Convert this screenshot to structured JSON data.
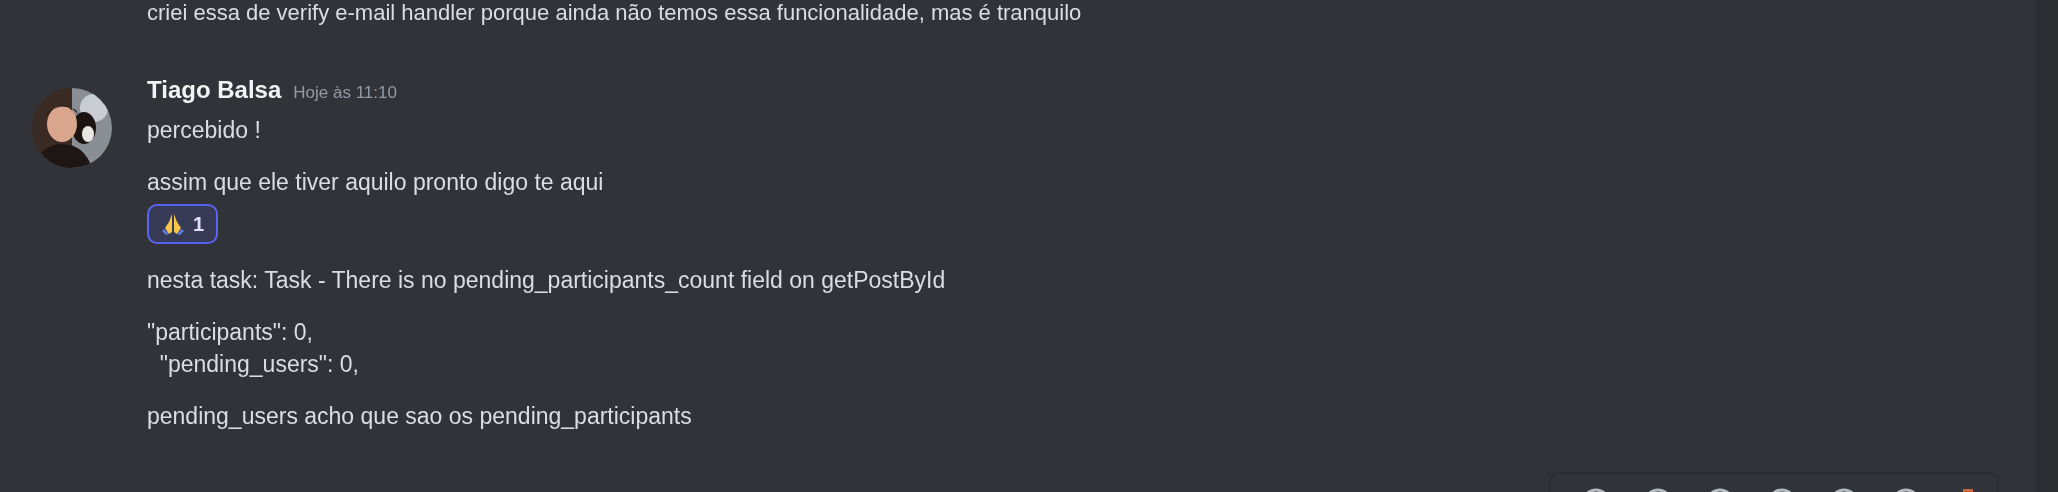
{
  "previous_message": {
    "text": "criei essa de verify e-mail handler porque ainda não temos essa funcionalidade, mas é tranquilo"
  },
  "message_group": {
    "author": "Tiago Balsa",
    "timestamp": "Hoje às 11:10",
    "messages": [
      {
        "lines": [
          "percebido !"
        ]
      },
      {
        "lines": [
          "assim que ele tiver aquilo pronto digo te aqui"
        ],
        "reactions": [
          {
            "count": "1",
            "selected": true
          }
        ]
      },
      {
        "lines": [
          "nesta task: Task - There is no pending_participants_count field on getPostById"
        ]
      },
      {
        "lines": [
          "\"participants\": 0,",
          "  \"pending_users\": 0,"
        ]
      },
      {
        "lines": [
          "pending_users acho que sao os pending_participants"
        ]
      }
    ]
  }
}
